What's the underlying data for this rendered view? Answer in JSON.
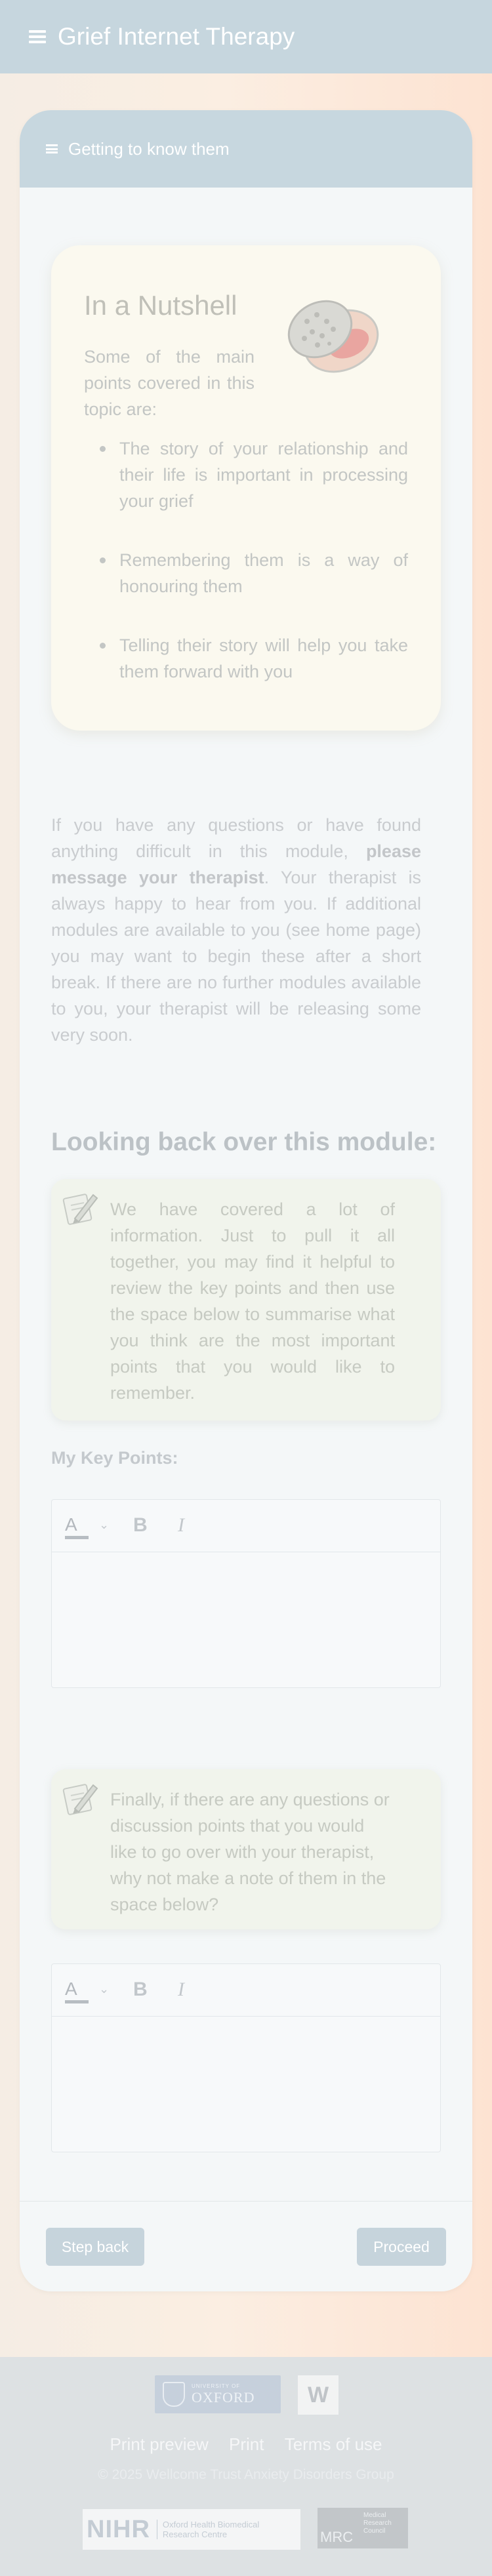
{
  "app": {
    "title": "Grief Internet Therapy"
  },
  "module": {
    "title": "Getting to know them"
  },
  "nutshell": {
    "title": "In a Nutshell",
    "intro": "Some of the main points covered in this topic are:",
    "points": [
      "The story of your relationship and their life is important in processing your grief",
      "Remembering them is a way of honouring them",
      "Telling their story will help you take them forward with you"
    ]
  },
  "message": {
    "part1": "If you have any questions or have found anything difficult in this module, ",
    "bold": "please message your therapist",
    "part2": ". Your therapist is always happy to hear from you. If additional modules are available to you (see home page) you may want to begin these after a short break. If there are no further modules available to you, your therapist will be releasing some very soon."
  },
  "review": {
    "title": "Looking back over this module:",
    "note1": "We have covered a lot of information. Just to pull it all together, you may find it helpful to review the key points and then use the space below to summarise what you think are the most important points that you would like to remember.",
    "key_points_label": "My Key Points:",
    "note2": "Finally, if there are any questions or discussion points that you would like to go over with your therapist, why not make a note of them in the space below?"
  },
  "editor": {
    "color_btn": "A",
    "bold_btn": "B",
    "italic_btn": "I",
    "caret": "⌄"
  },
  "nav": {
    "back": "Step back",
    "proceed": "Proceed"
  },
  "footer": {
    "oxford_small": "UNIVERSITY OF",
    "oxford_big": "OXFORD",
    "wellcome": "W",
    "links": [
      "Print preview",
      "Print",
      "Terms of use"
    ],
    "copyright": "© 2025 Wellcome Trust Anxiety Disorders Group",
    "nihr": "NIHR",
    "nihr_sub1": "Oxford Health Biomedical",
    "nihr_sub2": "Research Centre",
    "mrc": "MRC",
    "mrc_sub1": "Medical",
    "mrc_sub2": "Research",
    "mrc_sub3": "Council"
  },
  "colors": {
    "header": "#c6d6de",
    "card": "#f4f7f8",
    "nutshell_bg": "#fbf9ef",
    "note_bg": "#f1f4ec",
    "button": "#c6d4dc",
    "footer": "#dde1e3"
  },
  "icons": {
    "menu": "hamburger-icon",
    "nut": "walnut-icon",
    "note": "pencil-paper-icon"
  }
}
